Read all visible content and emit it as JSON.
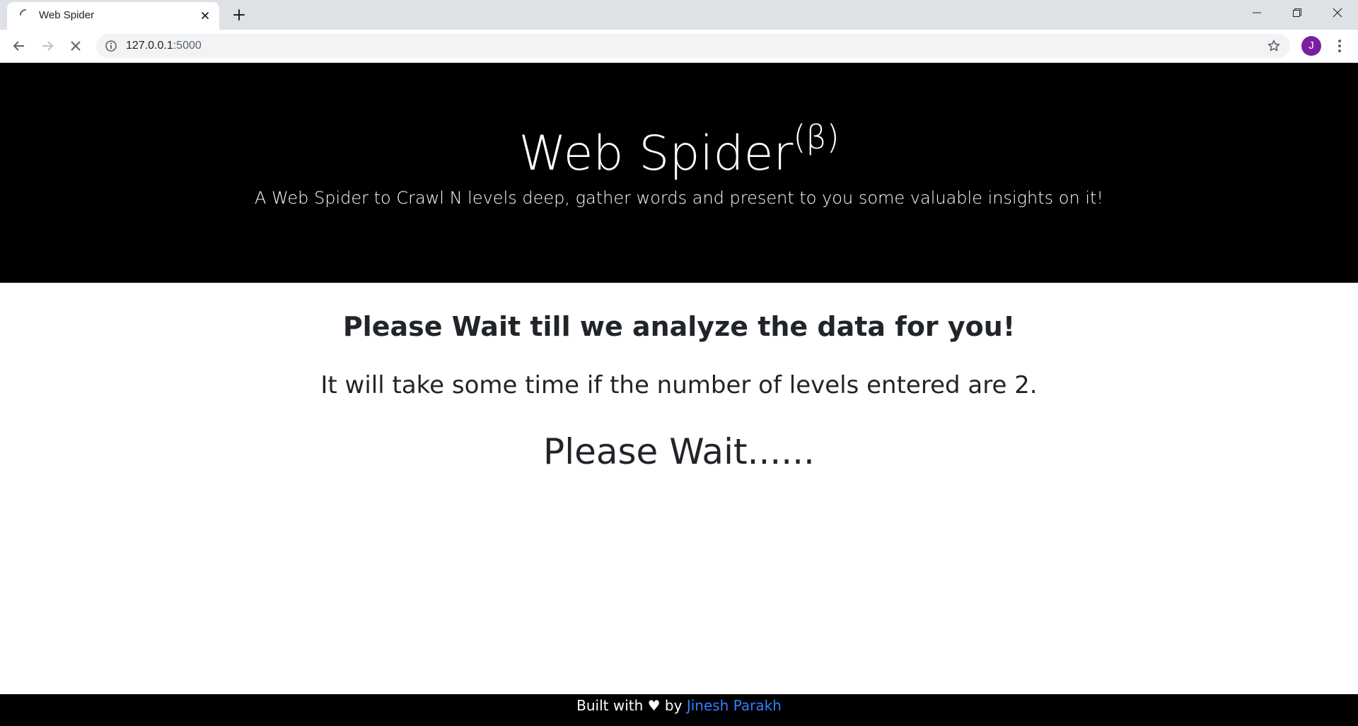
{
  "browser": {
    "tab": {
      "title": "Web Spider",
      "loading": true
    },
    "omnibox": {
      "url_host": "127.0.0.1",
      "url_port": ":5000"
    },
    "profile": {
      "initial": "J",
      "color": "#7b1fa2"
    },
    "icons": {
      "back": "arrow-left-icon",
      "forward": "arrow-right-icon",
      "stop": "close-icon",
      "info": "info-icon",
      "bookmark": "star-icon",
      "menu": "kebab-menu-icon",
      "new_tab": "plus-icon",
      "minimize": "minimize-icon",
      "restore": "restore-icon",
      "close_window": "close-icon"
    }
  },
  "hero": {
    "title": "Web Spider",
    "title_superscript": "(β)",
    "subtitle": "A Web Spider to Crawl N levels deep, gather words and present to you some valuable insights on it!",
    "background": "#000000"
  },
  "main": {
    "heading": "Please Wait till we analyze the data for you!",
    "levels_note": "It will take some time if the number of levels entered are 2.",
    "status": "Please Wait......"
  },
  "footer": {
    "prefix": "Built with ♥ by",
    "author_link": "Jinesh Parakh",
    "link_color": "#2f80ff"
  }
}
